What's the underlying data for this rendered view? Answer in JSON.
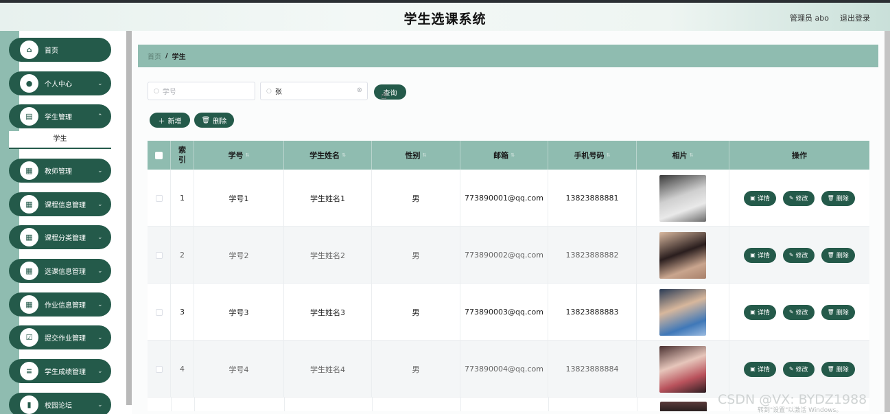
{
  "header": {
    "title": "学生选课系统",
    "user": "管理员 abo",
    "logout": "退出登录"
  },
  "sidebar": {
    "items": [
      {
        "label": "首页",
        "icon": "home-icon",
        "glyph": "⌂",
        "chevron": ""
      },
      {
        "label": "个人中心",
        "icon": "user-icon",
        "glyph": "●",
        "chevron": "⌄"
      },
      {
        "label": "学生管理",
        "icon": "clipboard-icon",
        "glyph": "▤",
        "chevron": "⌃"
      },
      {
        "label": "教师管理",
        "icon": "grid-icon",
        "glyph": "▦",
        "chevron": "⌄"
      },
      {
        "label": "课程信息管理",
        "icon": "grid-icon",
        "glyph": "▦",
        "chevron": "⌄"
      },
      {
        "label": "课程分类管理",
        "icon": "grid-icon",
        "glyph": "▦",
        "chevron": "⌄"
      },
      {
        "label": "选课信息管理",
        "icon": "grid-icon",
        "glyph": "▦",
        "chevron": "⌄"
      },
      {
        "label": "作业信息管理",
        "icon": "grid-icon",
        "glyph": "▦",
        "chevron": "⌄"
      },
      {
        "label": "提交作业管理",
        "icon": "check-square-icon",
        "glyph": "☑",
        "chevron": "⌄"
      },
      {
        "label": "学生成绩管理",
        "icon": "list-icon",
        "glyph": "≡",
        "chevron": "⌄"
      },
      {
        "label": "校园论坛",
        "icon": "bar-chart-icon",
        "glyph": "▮",
        "chevron": "⌄"
      }
    ],
    "submenu": "学生"
  },
  "breadcrumb": {
    "home": "首页",
    "separator": "/",
    "current": "学生"
  },
  "search": {
    "id_placeholder": "学号",
    "name_value": "张",
    "query_label": "查询"
  },
  "toolbar": {
    "add_label": "新增",
    "delete_label": "删除"
  },
  "table": {
    "columns": [
      "索引",
      "学号",
      "学生姓名",
      "性别",
      "邮箱",
      "手机号码",
      "相片",
      "操作"
    ],
    "rows": [
      {
        "index": "1",
        "id": "学号1",
        "name": "学生姓名1",
        "gender": "男",
        "email": "773890001@qq.com",
        "phone": "13823888881"
      },
      {
        "index": "2",
        "id": "学号2",
        "name": "学生姓名2",
        "gender": "男",
        "email": "773890002@qq.com",
        "phone": "13823888882"
      },
      {
        "index": "3",
        "id": "学号3",
        "name": "学生姓名3",
        "gender": "男",
        "email": "773890003@qq.com",
        "phone": "13823888883"
      },
      {
        "index": "4",
        "id": "学号4",
        "name": "学生姓名4",
        "gender": "男",
        "email": "773890004@qq.com",
        "phone": "13823888884"
      }
    ],
    "actions": {
      "detail": "详情",
      "edit": "修改",
      "delete": "删除"
    }
  },
  "watermark": "CSDN @VX: BYDZ1988",
  "windows_mark": "转到\"设置\"以激活 Windows。",
  "colors": {
    "primary": "#245a4a",
    "accent": "#8fbcb0"
  }
}
